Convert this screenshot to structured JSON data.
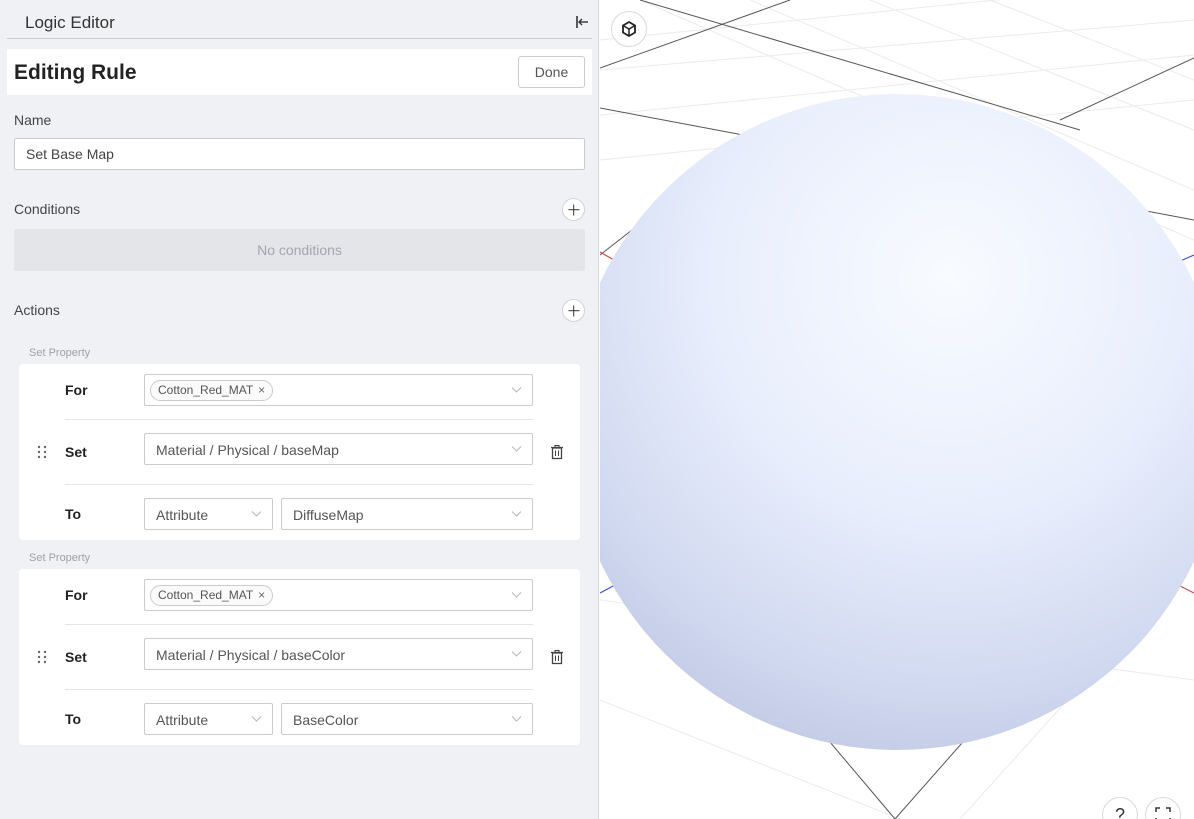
{
  "panel": {
    "title": "Logic Editor",
    "collapse_icon": "collapse-left-icon"
  },
  "rule": {
    "heading": "Editing Rule",
    "done_label": "Done"
  },
  "name_field": {
    "label": "Name",
    "value": "Set Base Map"
  },
  "conditions": {
    "label": "Conditions",
    "empty_text": "No conditions"
  },
  "actions": {
    "label": "Actions",
    "items": [
      {
        "group_title": "Set Property",
        "for_label": "For",
        "for_chip": "Cotton_Red_MAT",
        "set_label": "Set",
        "set_value": "Material / Physical / baseMap",
        "to_label": "To",
        "to_type": "Attribute",
        "to_value": "DiffuseMap"
      },
      {
        "group_title": "Set Property",
        "for_label": "For",
        "for_chip": "Cotton_Red_MAT",
        "set_label": "Set",
        "set_value": "Material / Physical / baseColor",
        "to_label": "To",
        "to_type": "Attribute",
        "to_value": "BaseColor"
      }
    ]
  },
  "viewport": {
    "help_label": "?",
    "icons": [
      "ar-cube-icon",
      "help-icon",
      "fullscreen-icon"
    ]
  },
  "colors": {
    "panel_bg": "#f0f1f4",
    "card_bg": "#ffffff",
    "sphere_light": "#f3f6ff",
    "sphere_dark": "#c3cbe6"
  }
}
